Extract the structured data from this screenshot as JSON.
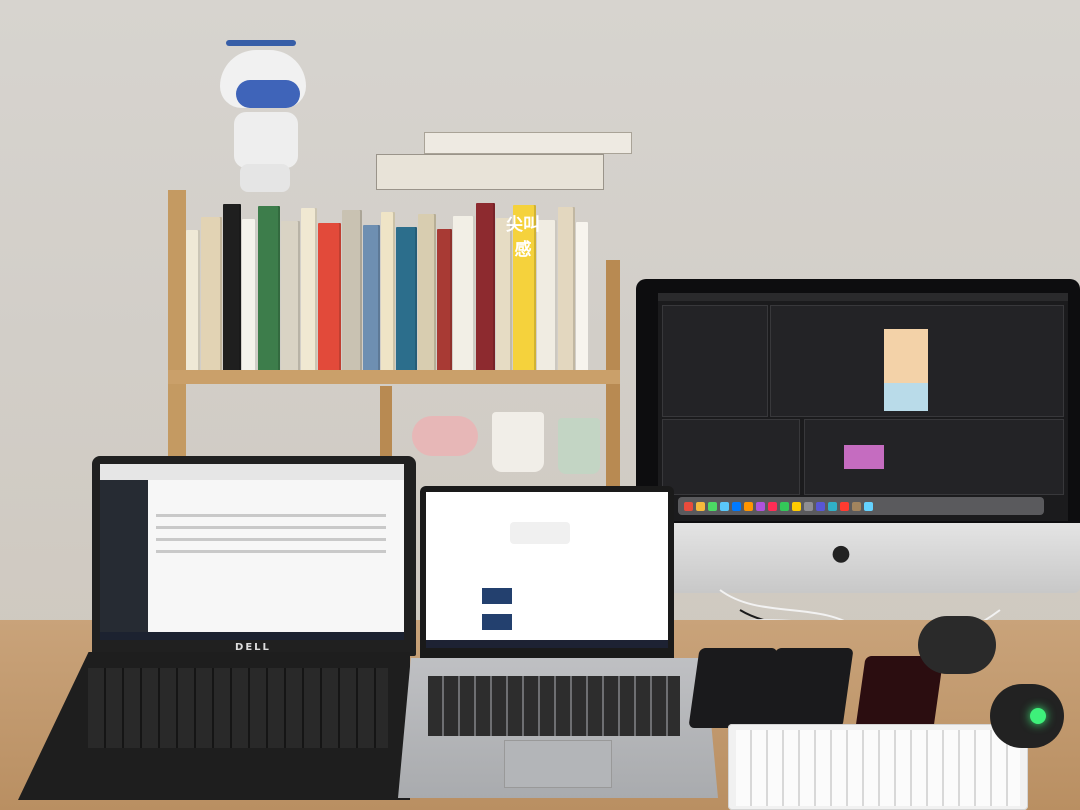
{
  "scene": {
    "description_free": true,
    "book_spine_text": "尖叫感",
    "laptop_brand": "DELL",
    "colors": {
      "wall": "#d7d4cf",
      "desk": "#c49c6f",
      "shelf": "#c49a62",
      "robot_visor": "#3f64b9",
      "mouse_glow": "#3ef07a"
    },
    "books": [
      "#efe9d6",
      "#e2d3b4",
      "#1f1f1f",
      "#f5f3ec",
      "#3d7d4b",
      "#d9d3c4",
      "#f0e8d2",
      "#e24a3a",
      "#c9c2b2",
      "#6e8fb2",
      "#efe4c6",
      "#2c6e8c",
      "#d8cdb0",
      "#a83a34",
      "#f2efe6",
      "#8d2a2f",
      "#e6dcc4",
      "#f5d23c",
      "#f0ece2",
      "#e3d7bf",
      "#f7f4ee"
    ],
    "dock_icons": [
      "#e94b3c",
      "#f6b93b",
      "#4cd964",
      "#5ac8fa",
      "#007aff",
      "#ff9500",
      "#af52de",
      "#ff2d55",
      "#34c759",
      "#ffcc00",
      "#8e8e93",
      "#5856d6",
      "#30b0c7",
      "#ff3b30",
      "#a2845e",
      "#64d2ff"
    ]
  }
}
